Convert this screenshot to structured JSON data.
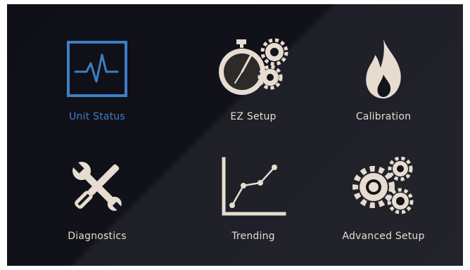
{
  "menu": {
    "items": [
      {
        "id": "unit-status",
        "label": "Unit Status",
        "icon": "pulse-monitor-icon",
        "selected": true
      },
      {
        "id": "ez-setup",
        "label": "EZ Setup",
        "icon": "stopwatch-gears-icon",
        "selected": false
      },
      {
        "id": "calibration",
        "label": "Calibration",
        "icon": "flame-icon",
        "selected": false
      },
      {
        "id": "diagnostics",
        "label": "Diagnostics",
        "icon": "wrench-screwdriver-icon",
        "selected": false
      },
      {
        "id": "trending",
        "label": "Trending",
        "icon": "line-chart-icon",
        "selected": false
      },
      {
        "id": "advanced-setup",
        "label": "Advanced Setup",
        "icon": "gears-icon",
        "selected": false
      }
    ]
  },
  "colors": {
    "selected": "#3d7fc4",
    "icon": "#e6dcd0",
    "background": "#14141c"
  }
}
